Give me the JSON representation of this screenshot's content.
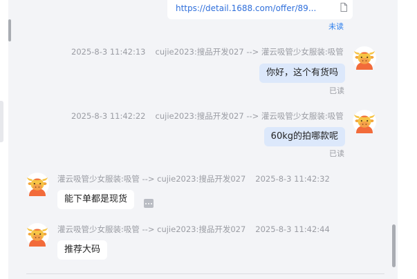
{
  "link_card": {
    "url": "https://detail.1688.com/offer/89...",
    "status": "未读"
  },
  "messages": [
    {
      "direction": "out",
      "time": "2025-8-3 11:42:13",
      "route": "cujie2023:搜品开发027 --> 灌云吸管少女服装:吸管",
      "text": "你好，这个有货吗",
      "status": "已读",
      "avatar": "cow-avatar-icon"
    },
    {
      "direction": "out",
      "time": "2025-8-3 11:42:22",
      "route": "cujie2023:搜品开发027 --> 灌云吸管少女服装:吸管",
      "text": "60kg的拍哪款呢",
      "status": "已读",
      "avatar": "cow-avatar-icon"
    },
    {
      "direction": "in",
      "route": "灌云吸管少女服装:吸管 --> cujie2023:搜品开发027",
      "time": "2025-8-3 11:42:32",
      "text": "能下单都是现货",
      "avatar": "cow-avatar-icon"
    },
    {
      "direction": "in",
      "route": "灌云吸管少女服装:吸管 --> cujie2023:搜品开发027",
      "time": "2025-8-3 11:42:44",
      "text": "推荐大码",
      "avatar": "cow-avatar-icon"
    }
  ],
  "colors": {
    "panel_background": "#f3f4f7",
    "outgoing_bubble": "#dce8fb",
    "incoming_bubble": "#ffffff",
    "link": "#2f6fdb",
    "unread_status": "#2f80ed",
    "read_status": "#9a9ca3",
    "meta_text": "#9a9ca3"
  }
}
